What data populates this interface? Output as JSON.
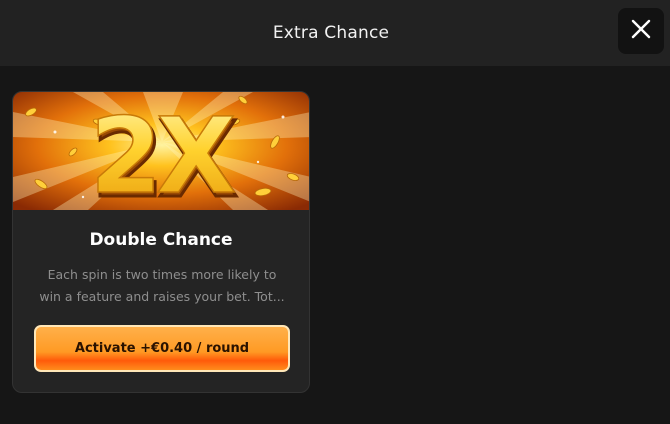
{
  "header": {
    "title": "Extra Chance"
  },
  "icons": {
    "close": "close-icon"
  },
  "card": {
    "banner_text": "2X",
    "title": "Double Chance",
    "description_line1": "Each spin is two times more likely to",
    "description_line2": "win a feature and raises your bet. Tot...",
    "button_label": "Activate +€0.40 / round"
  },
  "colors": {
    "background": "#161616",
    "header": "#222222",
    "card": "#242424",
    "button_orange": "#ff9a24",
    "banner_gold": "#ffd23a"
  }
}
